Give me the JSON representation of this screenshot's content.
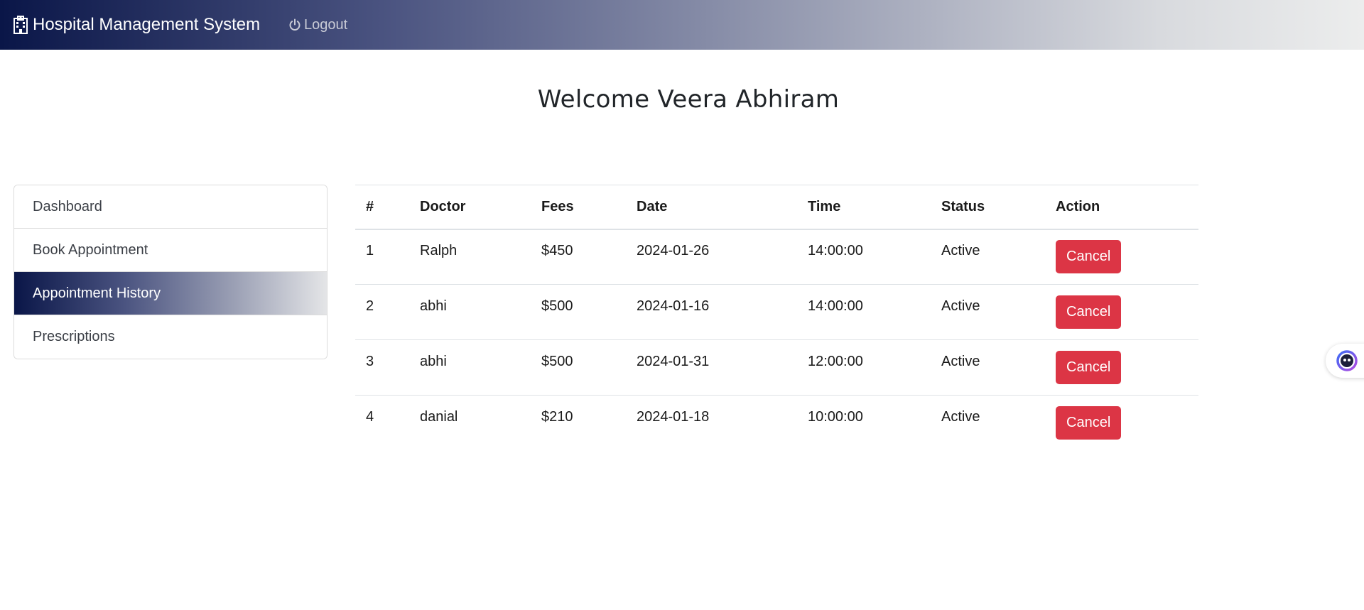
{
  "navbar": {
    "brand_icon": "hospital-icon",
    "brand_title": "Hospital Management System",
    "logout_icon": "power-icon",
    "logout_label": "Logout"
  },
  "welcome": {
    "text": "Welcome  Veera Abhiram"
  },
  "sidebar": {
    "items": [
      {
        "label": "Dashboard",
        "active": false
      },
      {
        "label": "Book Appointment",
        "active": false
      },
      {
        "label": "Appointment History",
        "active": true
      },
      {
        "label": "Prescriptions",
        "active": false
      }
    ]
  },
  "table": {
    "headers": [
      "#",
      "Doctor",
      "Fees",
      "Date",
      "Time",
      "Status",
      "Action"
    ],
    "rows": [
      {
        "num": "1",
        "doctor": "Ralph",
        "fees": "$450",
        "date": "2024-01-26",
        "time": "14:00:00",
        "status": "Active",
        "action": "Cancel"
      },
      {
        "num": "2",
        "doctor": "abhi",
        "fees": "$500",
        "date": "2024-01-16",
        "time": "14:00:00",
        "status": "Active",
        "action": "Cancel"
      },
      {
        "num": "3",
        "doctor": "abhi",
        "fees": "$500",
        "date": "2024-01-31",
        "time": "12:00:00",
        "status": "Active",
        "action": "Cancel"
      },
      {
        "num": "4",
        "doctor": "danial",
        "fees": "$210",
        "date": "2024-01-18",
        "time": "10:00:00",
        "status": "Active",
        "action": "Cancel"
      }
    ]
  },
  "widget": {
    "icon": "chat-bot-icon"
  },
  "colors": {
    "navbar_start": "#0a1648",
    "cancel_button": "#dc3545"
  }
}
